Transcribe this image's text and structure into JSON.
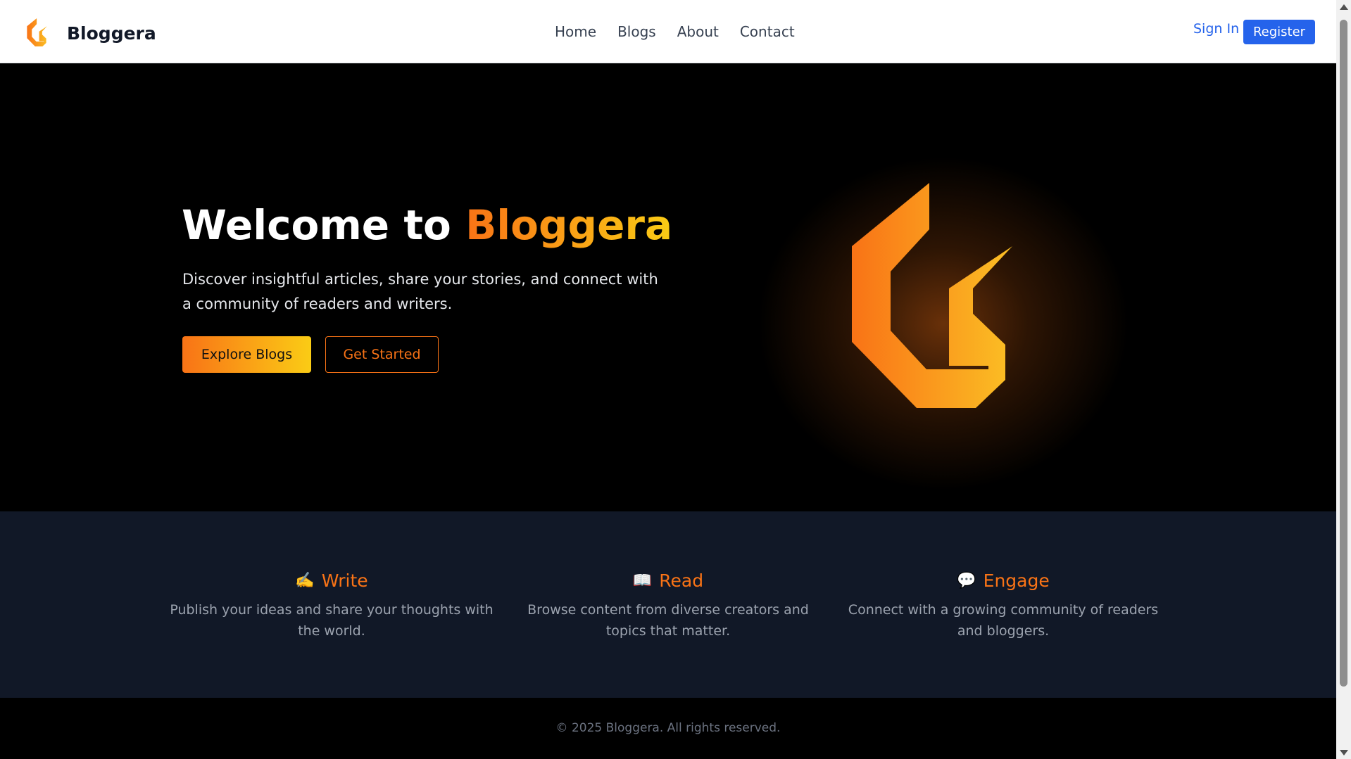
{
  "header": {
    "brand": "Bloggera",
    "nav": [
      "Home",
      "Blogs",
      "About",
      "Contact"
    ],
    "sign_in": "Sign In",
    "register": "Register"
  },
  "hero": {
    "title_prefix": "Welcome to ",
    "title_accent": "Bloggera",
    "subtitle": "Discover insightful articles, share your stories, and connect with a community of readers and writers.",
    "explore_button": "Explore Blogs",
    "get_started_button": "Get Started"
  },
  "features": [
    {
      "icon": "✍️",
      "icon_name": "writing-hand-icon",
      "title": "Write",
      "description": "Publish your ideas and share your thoughts with the world."
    },
    {
      "icon": "📖",
      "icon_name": "open-book-icon",
      "title": "Read",
      "description": "Browse content from diverse creators and topics that matter."
    },
    {
      "icon": "💬",
      "icon_name": "speech-bubble-icon",
      "title": "Engage",
      "description": "Connect with a growing community of readers and bloggers."
    }
  ],
  "footer": {
    "text": "© 2025 Bloggera. All rights reserved."
  },
  "colors": {
    "accent_start": "#f97316",
    "accent_end": "#facc15",
    "link_blue": "#2563eb",
    "features_bg": "#111827"
  }
}
